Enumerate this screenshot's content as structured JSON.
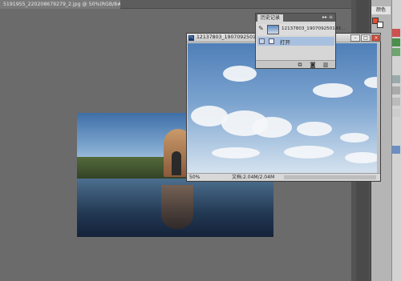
{
  "document": {
    "tab_title": "5191955_220208679279_2.jpg @ 50%(RGB/8#)"
  },
  "history_panel": {
    "tab_label": "历史记录",
    "controls": "▸▸ ≡",
    "snapshot_label": "12137803_190709250143...",
    "items": [
      {
        "label": "打开"
      }
    ],
    "footer_icons": [
      "new-document-from-state-icon",
      "camera-snapshot-icon",
      "trash-icon"
    ]
  },
  "floating_window": {
    "title": "12137803_190709250143_2.jpg @ 50%(RGB/8#)",
    "zoom": "50%",
    "doc_info": "文档:2.04M/2.04M",
    "buttons": {
      "minimize": "–",
      "maximize": "□",
      "close": "×"
    }
  },
  "right_dock": {
    "color_tab_label": "颜色",
    "foreground_color": "#e84b2b",
    "background_color": "#ffffff"
  }
}
